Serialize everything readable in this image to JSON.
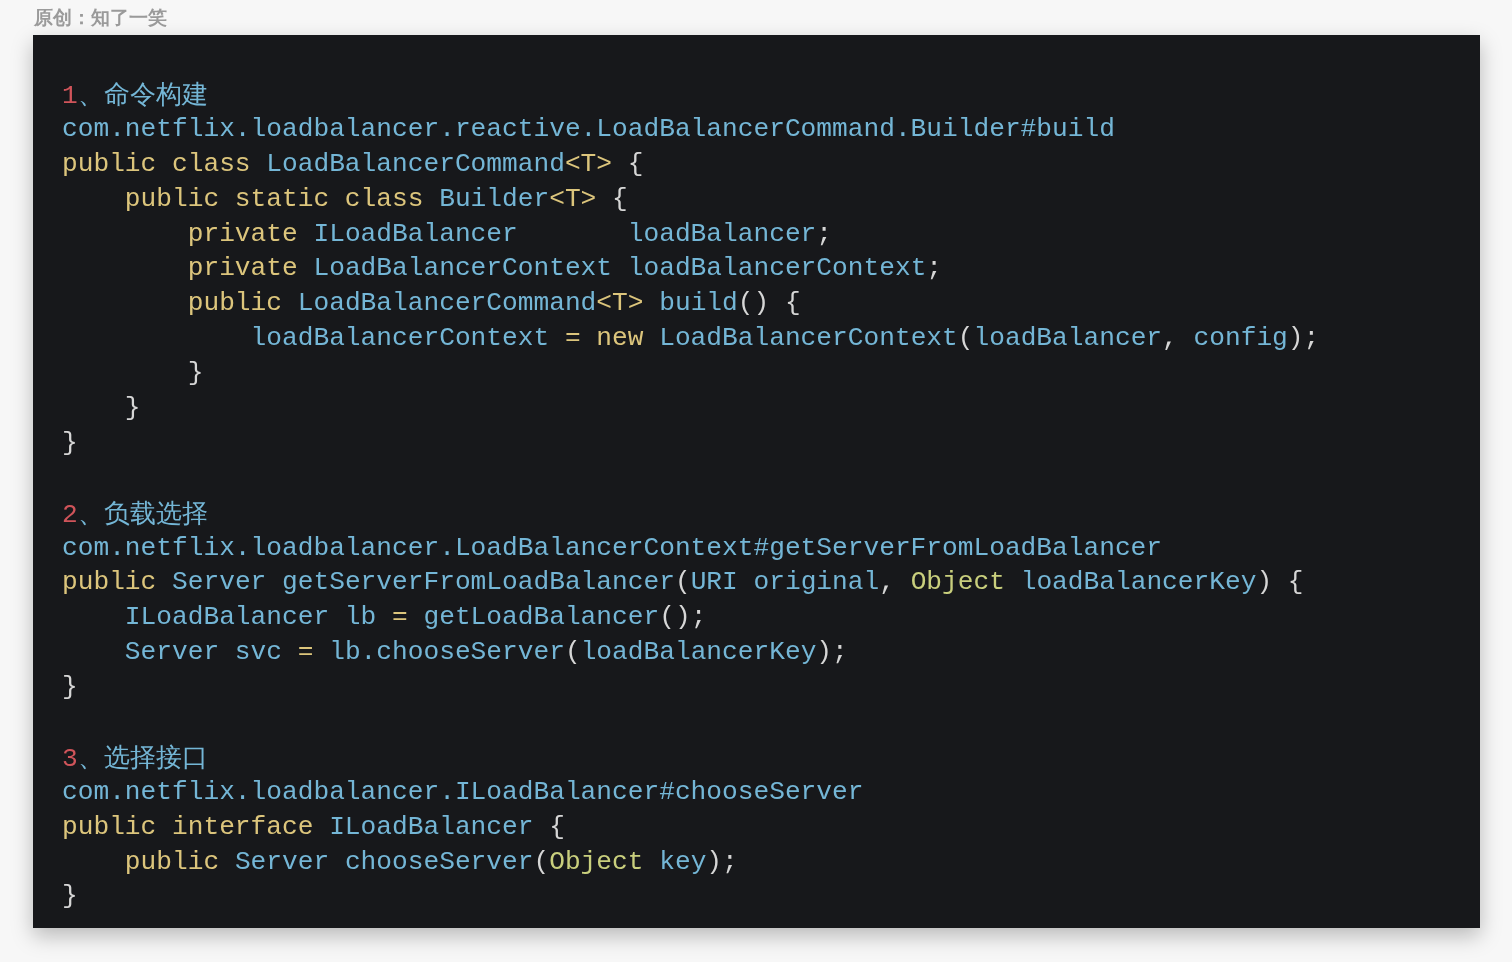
{
  "caption": "原创：知了一笑",
  "sections": [
    {
      "heading": [
        {
          "kind": "num",
          "text": "1"
        },
        {
          "kind": "id",
          "text": "、命令构建"
        }
      ],
      "lines": [
        [
          {
            "kind": "id",
            "text": "com.netflix.loadbalancer.reactive.LoadBalancerCommand.Builder#build"
          }
        ],
        [
          {
            "kind": "kw",
            "text": "public class "
          },
          {
            "kind": "id",
            "text": "LoadBalancerCommand"
          },
          {
            "kind": "kw",
            "text": "<T>"
          },
          {
            "kind": "pl",
            "text": " {"
          }
        ],
        [
          {
            "kind": "kw",
            "text": "    public static class "
          },
          {
            "kind": "id",
            "text": "Builder"
          },
          {
            "kind": "kw",
            "text": "<T>"
          },
          {
            "kind": "pl",
            "text": " {"
          }
        ],
        [
          {
            "kind": "kw",
            "text": "        private "
          },
          {
            "kind": "id",
            "text": "ILoadBalancer       loadBalancer"
          },
          {
            "kind": "pl",
            "text": ";"
          }
        ],
        [
          {
            "kind": "kw",
            "text": "        private "
          },
          {
            "kind": "id",
            "text": "LoadBalancerContext loadBalancerContext"
          },
          {
            "kind": "pl",
            "text": ";"
          }
        ],
        [
          {
            "kind": "kw",
            "text": "        public "
          },
          {
            "kind": "id",
            "text": "LoadBalancerCommand"
          },
          {
            "kind": "kw",
            "text": "<T>"
          },
          {
            "kind": "id",
            "text": " build"
          },
          {
            "kind": "pl",
            "text": "() {"
          }
        ],
        [
          {
            "kind": "id",
            "text": "            loadBalancerContext "
          },
          {
            "kind": "kw",
            "text": "= new "
          },
          {
            "kind": "id",
            "text": "LoadBalancerContext"
          },
          {
            "kind": "pl",
            "text": "("
          },
          {
            "kind": "id",
            "text": "loadBalancer"
          },
          {
            "kind": "pl",
            "text": ", "
          },
          {
            "kind": "id",
            "text": "config"
          },
          {
            "kind": "pl",
            "text": ");"
          }
        ],
        [
          {
            "kind": "pl",
            "text": "        }"
          }
        ],
        [
          {
            "kind": "pl",
            "text": "    }"
          }
        ],
        [
          {
            "kind": "pl",
            "text": "}"
          }
        ]
      ]
    },
    {
      "heading": [
        {
          "kind": "num",
          "text": "2"
        },
        {
          "kind": "id",
          "text": "、负载选择"
        }
      ],
      "lines": [
        [
          {
            "kind": "id",
            "text": "com.netflix.loadbalancer.LoadBalancerContext#getServerFromLoadBalancer"
          }
        ],
        [
          {
            "kind": "kw",
            "text": "public "
          },
          {
            "kind": "id",
            "text": "Server getServerFromLoadBalancer"
          },
          {
            "kind": "pl",
            "text": "("
          },
          {
            "kind": "id",
            "text": "URI original"
          },
          {
            "kind": "pl",
            "text": ", "
          },
          {
            "kind": "obj",
            "text": "Object "
          },
          {
            "kind": "id",
            "text": "loadBalancerKey"
          },
          {
            "kind": "pl",
            "text": ") {"
          }
        ],
        [
          {
            "kind": "id",
            "text": "    ILoadBalancer lb "
          },
          {
            "kind": "kw",
            "text": "= "
          },
          {
            "kind": "id",
            "text": "getLoadBalancer"
          },
          {
            "kind": "pl",
            "text": "();"
          }
        ],
        [
          {
            "kind": "id",
            "text": "    Server svc "
          },
          {
            "kind": "kw",
            "text": "= "
          },
          {
            "kind": "id",
            "text": "lb.chooseServer"
          },
          {
            "kind": "pl",
            "text": "("
          },
          {
            "kind": "id",
            "text": "loadBalancerKey"
          },
          {
            "kind": "pl",
            "text": ");"
          }
        ],
        [
          {
            "kind": "pl",
            "text": "}"
          }
        ]
      ]
    },
    {
      "heading": [
        {
          "kind": "num",
          "text": "3"
        },
        {
          "kind": "id",
          "text": "、选择接口"
        }
      ],
      "lines": [
        [
          {
            "kind": "id",
            "text": "com.netflix.loadbalancer.ILoadBalancer#chooseServer"
          }
        ],
        [
          {
            "kind": "kw",
            "text": "public interface "
          },
          {
            "kind": "id",
            "text": "ILoadBalancer"
          },
          {
            "kind": "pl",
            "text": " {"
          }
        ],
        [
          {
            "kind": "kw",
            "text": "    public "
          },
          {
            "kind": "id",
            "text": "Server chooseServer"
          },
          {
            "kind": "pl",
            "text": "("
          },
          {
            "kind": "obj",
            "text": "Object "
          },
          {
            "kind": "id",
            "text": "key"
          },
          {
            "kind": "pl",
            "text": ");"
          }
        ],
        [
          {
            "kind": "pl",
            "text": "}"
          }
        ]
      ]
    }
  ]
}
